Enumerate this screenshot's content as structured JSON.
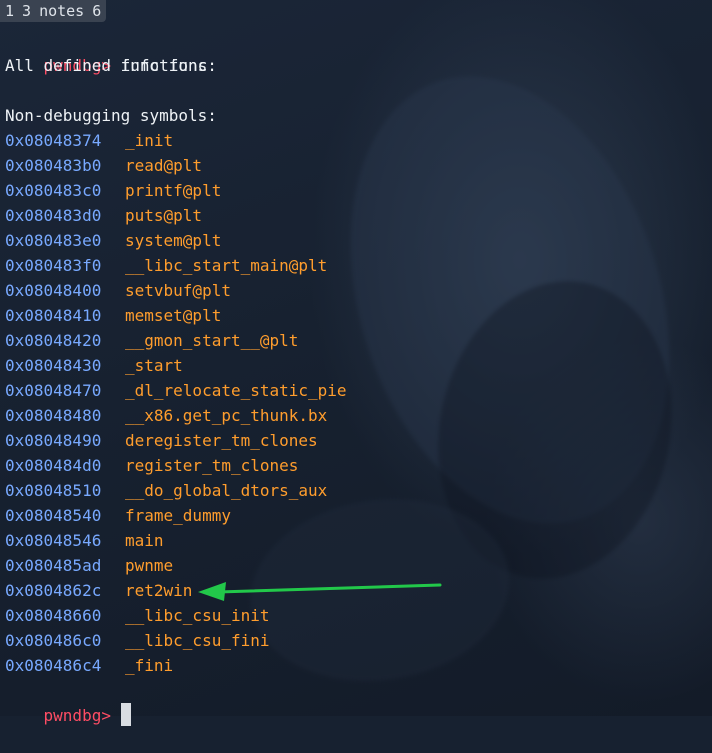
{
  "tabbar": {
    "items": [
      "1",
      "3",
      "notes",
      "6"
    ]
  },
  "terminal": {
    "prompt": "pwndbg>",
    "command": "info func",
    "header1": "All defined functions:",
    "header2": "Non-debugging symbols:",
    "functions": [
      {
        "address": "0x08048374",
        "name": "_init"
      },
      {
        "address": "0x080483b0",
        "name": "read@plt"
      },
      {
        "address": "0x080483c0",
        "name": "printf@plt"
      },
      {
        "address": "0x080483d0",
        "name": "puts@plt"
      },
      {
        "address": "0x080483e0",
        "name": "system@plt"
      },
      {
        "address": "0x080483f0",
        "name": "__libc_start_main@plt"
      },
      {
        "address": "0x08048400",
        "name": "setvbuf@plt"
      },
      {
        "address": "0x08048410",
        "name": "memset@plt"
      },
      {
        "address": "0x08048420",
        "name": "__gmon_start__@plt"
      },
      {
        "address": "0x08048430",
        "name": "_start"
      },
      {
        "address": "0x08048470",
        "name": "_dl_relocate_static_pie"
      },
      {
        "address": "0x08048480",
        "name": "__x86.get_pc_thunk.bx"
      },
      {
        "address": "0x08048490",
        "name": "deregister_tm_clones"
      },
      {
        "address": "0x080484d0",
        "name": "register_tm_clones"
      },
      {
        "address": "0x08048510",
        "name": "__do_global_dtors_aux"
      },
      {
        "address": "0x08048540",
        "name": "frame_dummy"
      },
      {
        "address": "0x08048546",
        "name": "main"
      },
      {
        "address": "0x080485ad",
        "name": "pwnme"
      },
      {
        "address": "0x0804862c",
        "name": "ret2win"
      },
      {
        "address": "0x08048660",
        "name": "__libc_csu_init"
      },
      {
        "address": "0x080486c0",
        "name": "__libc_csu_fini"
      },
      {
        "address": "0x080486c4",
        "name": "_fini"
      }
    ],
    "final_prompt": "pwndbg>"
  },
  "colors": {
    "background": "#172130",
    "prompt": "#ff4d64",
    "address": "#78a9ff",
    "symbol": "#ff9d2d",
    "arrow": "#22c84a"
  },
  "icons": {
    "annotation": "green-arrow-icon"
  }
}
